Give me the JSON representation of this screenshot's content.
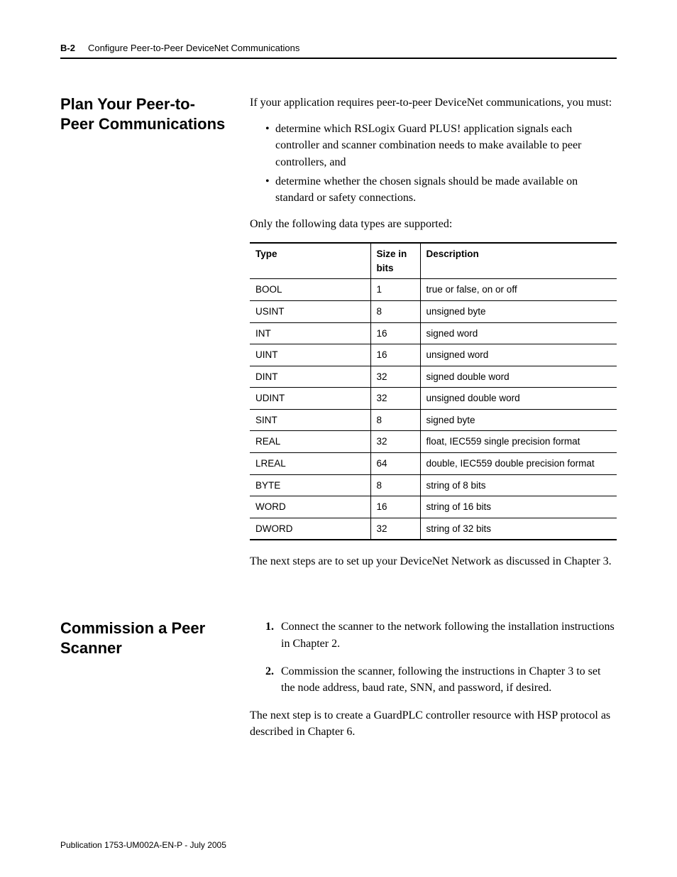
{
  "header": {
    "page_number": "B-2",
    "running_title": "Configure Peer-to-Peer DeviceNet Communications"
  },
  "section1": {
    "title": "Plan Your Peer-to-Peer Communications",
    "intro": "If your application requires peer-to-peer DeviceNet communications, you must:",
    "bullets": [
      "determine which RSLogix Guard PLUS! application signals each controller and scanner combination needs to make available to peer controllers, and",
      "determine whether the chosen signals should be made available on standard or safety connections."
    ],
    "before_table": "Only the following data types are supported:",
    "table": {
      "headers": {
        "type": "Type",
        "size": "Size in bits",
        "desc": "Description"
      },
      "rows": [
        {
          "type": "BOOL",
          "size": "1",
          "desc": "true or false, on or off"
        },
        {
          "type": "USINT",
          "size": "8",
          "desc": "unsigned byte"
        },
        {
          "type": "INT",
          "size": "16",
          "desc": "signed word"
        },
        {
          "type": "UINT",
          "size": "16",
          "desc": "unsigned word"
        },
        {
          "type": "DINT",
          "size": "32",
          "desc": "signed double word"
        },
        {
          "type": "UDINT",
          "size": "32",
          "desc": "unsigned double word"
        },
        {
          "type": "SINT",
          "size": "8",
          "desc": "signed byte"
        },
        {
          "type": "REAL",
          "size": "32",
          "desc": "float, IEC559 single precision format"
        },
        {
          "type": "LREAL",
          "size": "64",
          "desc": "double, IEC559 double precision format"
        },
        {
          "type": "BYTE",
          "size": "8",
          "desc": "string of 8 bits"
        },
        {
          "type": "WORD",
          "size": "16",
          "desc": "string of 16 bits"
        },
        {
          "type": "DWORD",
          "size": "32",
          "desc": "string of 32 bits"
        }
      ]
    },
    "after_table": "The next steps are to set up your DeviceNet Network as discussed in Chapter 3."
  },
  "section2": {
    "title": "Commission a Peer Scanner",
    "steps": [
      {
        "num": "1.",
        "text": "Connect the scanner to the network following the installation instructions in Chapter 2."
      },
      {
        "num": "2.",
        "text": "Commission the scanner, following the instructions in Chapter 3 to set the node address, baud rate, SNN, and password, if desired."
      }
    ],
    "after": "The next step is to create a GuardPLC controller resource with HSP protocol as described in Chapter 6."
  },
  "footer": "Publication 1753-UM002A-EN-P - July 2005"
}
